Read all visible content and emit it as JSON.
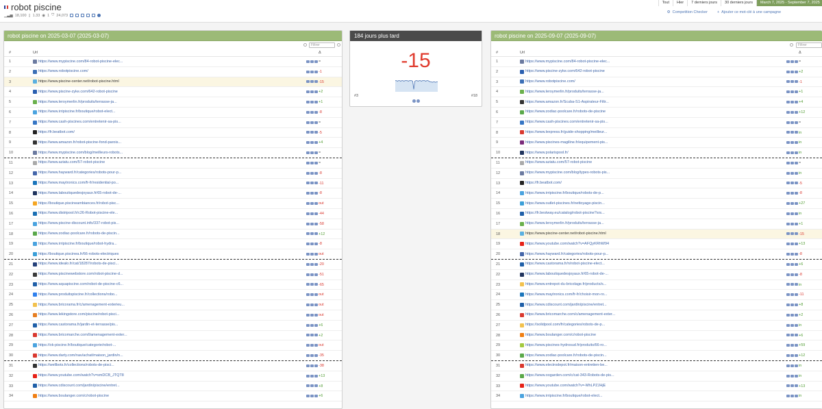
{
  "header": {
    "title": "robot piscine",
    "meta": {
      "volume": "18,100",
      "cpc": "1.33",
      "competition": "1",
      "results": "24,073"
    },
    "flag_colors": [
      "#1f3a93",
      "#ffffff",
      "#d9382f"
    ]
  },
  "period_tabs": [
    {
      "label": "Tout"
    },
    {
      "label": "Hier"
    },
    {
      "label": "7 derniers jours"
    },
    {
      "label": "30 derniers jours"
    },
    {
      "label": "March 7, 2025 - September 7, 2025"
    }
  ],
  "actions": {
    "competition_checker": "Competition Checker",
    "add_keyword": "Ajouter ce mot-clé à une campagne"
  },
  "filter_placeholder": "Filtrer",
  "columns": {
    "num": "#",
    "url": "Url",
    "delta": "Δ"
  },
  "left": {
    "title": "robot piscine on 2025-03-07 (2025-03-07)",
    "rows": [
      {
        "n": "1",
        "url": "https://www.mypiscine.com/84-robot-piscine-elec...",
        "d": "=",
        "t": "eq",
        "fav": "#6b7aa0"
      },
      {
        "n": "2",
        "url": "https://www.robotpiscine.com/",
        "d": "-1",
        "t": "neg",
        "fav": "#3b6fb6"
      },
      {
        "n": "3",
        "url": "https://www.piscine-center.net/robot-piscine.html",
        "d": "-15",
        "t": "neg",
        "fav": "#5ab0e0"
      },
      {
        "n": "4",
        "url": "https://www.piscine-zyke.com/642-robot-piscine",
        "d": "+2",
        "t": "pos",
        "fav": "#2a5fb0"
      },
      {
        "n": "5",
        "url": "https://www.leroymerlin.fr/produits/terrasse-ja...",
        "d": "+1",
        "t": "pos",
        "fav": "#6ab04c"
      },
      {
        "n": "6",
        "url": "https://www.irripiscine.fr/boutique/robot-elect...",
        "d": "-8",
        "t": "neg",
        "fav": "#4aa3df"
      },
      {
        "n": "7",
        "url": "https://www.cash-piscines.com/entretenir-sa-pis...",
        "d": "=",
        "t": "eq",
        "fav": "#3575c4"
      },
      {
        "n": "8",
        "url": "https://fr.beatbot.com/",
        "d": "-5",
        "t": "neg",
        "fav": "#222222"
      },
      {
        "n": "9",
        "url": "https://www.amazon.fr/robot-piscine-fond-parois...",
        "d": "+4",
        "t": "pos",
        "fav": "#333333"
      },
      {
        "n": "10",
        "url": "https://www.mypiscine.com/blog/meilleurs-robots...",
        "d": "=",
        "t": "eq",
        "fav": "#6b7aa0"
      },
      {
        "n": "11",
        "url": "https://www.aziatu.com/57-robot-piscine",
        "d": "=",
        "t": "eq",
        "fav": "#aaaaaa"
      },
      {
        "n": "12",
        "url": "https://www.hayward.fr/categories/robots-pour-p...",
        "d": "-8",
        "t": "neg",
        "fav": "#4466aa"
      },
      {
        "n": "13",
        "url": "https://www.maytronics.com/fr-fr/residential-po...",
        "d": "-11",
        "t": "neg",
        "fav": "#1a75bb"
      },
      {
        "n": "14",
        "url": "https://www.laboutiquedesjoyaux.fr/65-robot-de-...",
        "d": "-8",
        "t": "neg",
        "fav": "#20345e"
      },
      {
        "n": "15",
        "url": "https://boutique.piscineambiances.fr/robot-pisc...",
        "d": "out",
        "t": "out",
        "fav": "#f5a623"
      },
      {
        "n": "16",
        "url": "https://www.distripool.fr/c26-Robot-piscine-ele...",
        "d": "-44",
        "t": "neg",
        "fav": "#1a6fb3"
      },
      {
        "n": "17",
        "url": "https://www.piscine-discount.info/337-robot-pis...",
        "d": "-58",
        "t": "neg",
        "fav": "#4aa3df"
      },
      {
        "n": "18",
        "url": "https://www.zodiac-poolcare.fr/robots-de-piscin...",
        "d": "+12",
        "t": "pos",
        "fav": "#5aa84a"
      },
      {
        "n": "19",
        "url": "https://www.irripiscine.fr/boutique/robot-hydra...",
        "d": "-8",
        "t": "neg",
        "fav": "#4aa3df"
      },
      {
        "n": "20",
        "url": "https://boutique.piscinea.fr/66-robots-electriques",
        "d": "out",
        "t": "out",
        "fav": "#3b9fd8"
      },
      {
        "n": "21",
        "url": "https://www.idealo.fr/cat/18287/robots-de-pisci...",
        "d": "-20",
        "t": "neg",
        "fav": "#24407a"
      },
      {
        "n": "22",
        "url": "https://www.piscinewebstore.com/robot-piscine-d...",
        "d": "-51",
        "t": "neg",
        "fav": "#3a3a3a"
      },
      {
        "n": "23",
        "url": "https://www.aquapiscine.com/robot-de-piscine-c6...",
        "d": "-65",
        "t": "neg",
        "fav": "#1f5fa8"
      },
      {
        "n": "24",
        "url": "https://www.produitspiscine.fr/collections/robo...",
        "d": "out",
        "t": "out",
        "fav": "#2f80ed"
      },
      {
        "n": "25",
        "url": "https://www.bricorama.fr/c/amenagement-exterieu...",
        "d": "out",
        "t": "out",
        "fav": "#f2c14e"
      },
      {
        "n": "26",
        "url": "https://www.lekingstore.com/piscine/robot-pisci...",
        "d": "out",
        "t": "out",
        "fav": "#e67e22"
      },
      {
        "n": "27",
        "url": "https://www.castorama.fr/jardin-et-terrasse/pis...",
        "d": "+6",
        "t": "pos",
        "fav": "#1f5fa8"
      },
      {
        "n": "28",
        "url": "https://www.bricomarche.com/l/amenagement-exter...",
        "d": "+2",
        "t": "pos",
        "fav": "#d9382f"
      },
      {
        "n": "29",
        "url": "https://ok-piscine.fr/boutique/categorie/robot-...",
        "d": "out",
        "t": "out",
        "fav": "#4aa3df"
      },
      {
        "n": "30",
        "url": "https://www.darty.com/nav/achat/maison_jardin/n...",
        "d": "-35",
        "t": "neg",
        "fav": "#d9382f"
      },
      {
        "n": "31",
        "url": "https://wellbots.fr/collections/robots-de-pisci...",
        "d": "-38",
        "t": "neg",
        "fav": "#333333"
      },
      {
        "n": "32",
        "url": "https://www.youtube.com/watch?v=smDCB_JTQT8",
        "d": "+13",
        "t": "pos",
        "fav": "#e62117"
      },
      {
        "n": "33",
        "url": "https://www.cdiscount.com/jardin/piscine/entret...",
        "d": "+8",
        "t": "pos",
        "fav": "#1f5fa8"
      },
      {
        "n": "34",
        "url": "https://www.boulanger.com/c/robot-piscine",
        "d": "+6",
        "t": "pos",
        "fav": "#f07f13"
      }
    ]
  },
  "middle": {
    "title": "184 jours plus tard",
    "delta": "-15",
    "rank_from": "#3",
    "rank_to": "#18",
    "spark": [
      3,
      3,
      4,
      3,
      3,
      4,
      3,
      3,
      4,
      3,
      3,
      3,
      4,
      3,
      3,
      3,
      4,
      18,
      4,
      3,
      3,
      4,
      3,
      3,
      4,
      3,
      3,
      3,
      4,
      3,
      3,
      4,
      5,
      5,
      6,
      5,
      5,
      6,
      5,
      5
    ]
  },
  "right": {
    "title": "robot piscine on 2025-09-07 (2025-09-07)",
    "rows": [
      {
        "n": "1",
        "url": "https://www.mypiscine.com/84-robot-piscine-elec...",
        "d": "=",
        "t": "eq",
        "fav": "#6b7aa0"
      },
      {
        "n": "2",
        "url": "https://www.piscine-zyke.com/642-robot-piscine",
        "d": "+2",
        "t": "pos",
        "fav": "#2a5fb0"
      },
      {
        "n": "3",
        "url": "https://www.robotpiscine.com/",
        "d": "-1",
        "t": "neg",
        "fav": "#3b6fb6"
      },
      {
        "n": "4",
        "url": "https://www.leroymerlin.fr/produits/terrasse-ja...",
        "d": "+1",
        "t": "pos",
        "fav": "#6ab04c"
      },
      {
        "n": "5",
        "url": "https://www.amazon.fr/Scuba-S1-Aspirateur-Filtr...",
        "d": "+4",
        "t": "pos",
        "fav": "#333333"
      },
      {
        "n": "6",
        "url": "https://www.zodiac-poolcare.fr/robots-de-piscine",
        "d": "+12",
        "t": "pos",
        "fav": "#5aa84a"
      },
      {
        "n": "7",
        "url": "https://www.cash-piscines.com/entretenir-sa-pis...",
        "d": "=",
        "t": "eq",
        "fav": "#3575c4"
      },
      {
        "n": "8",
        "url": "https://www.lexpress.fr/guide-shopping/meilleur...",
        "d": "in",
        "t": "in",
        "fav": "#d9382f"
      },
      {
        "n": "9",
        "url": "https://www.piscines-magiline.fr/equipement-pis...",
        "d": "in",
        "t": "in",
        "fav": "#7a2a7a"
      },
      {
        "n": "10",
        "url": "https://www.polarispool.fr/",
        "d": "in",
        "t": "in",
        "fav": "#20345e"
      },
      {
        "n": "11",
        "url": "https://www.aziatu.com/57-robot-piscine",
        "d": "=",
        "t": "eq",
        "fav": "#aaaaaa"
      },
      {
        "n": "12",
        "url": "https://www.mypiscine.com/blog/types-robots-pis...",
        "d": "in",
        "t": "in",
        "fav": "#6b7aa0"
      },
      {
        "n": "13",
        "url": "https://fr.beatbot.com/",
        "d": "-5",
        "t": "neg",
        "fav": "#222222"
      },
      {
        "n": "14",
        "url": "https://www.irripiscine.fr/boutique/robots-de-p...",
        "d": "-8",
        "t": "neg",
        "fav": "#4aa3df"
      },
      {
        "n": "15",
        "url": "https://www.outlet-piscines.fr/nettoyage-piscin...",
        "d": "+27",
        "t": "pos",
        "fav": "#3b9fd8"
      },
      {
        "n": "16",
        "url": "https://fr.bestway.eu/catalog/robot-piscine?srs...",
        "d": "in",
        "t": "in",
        "fav": "#1f5fa8"
      },
      {
        "n": "17",
        "url": "https://www.leroymerlin.fr/produits/terrasse-ja...",
        "d": "+1",
        "t": "pos",
        "fav": "#6ab04c"
      },
      {
        "n": "18",
        "url": "https://www.piscine-center.net/robot-piscine.html",
        "d": "-15",
        "t": "neg",
        "fav": "#5ab0e0"
      },
      {
        "n": "19",
        "url": "https://www.youtube.com/watch?v=AFQyKRhW94",
        "d": "+13",
        "t": "pos",
        "fav": "#e62117"
      },
      {
        "n": "20",
        "url": "https://www.hayward.fr/categories/robots-pour-p...",
        "d": "-8",
        "t": "neg",
        "fav": "#4466aa"
      },
      {
        "n": "21",
        "url": "https://www.castorama.fr/n/robot-piscine-elect...",
        "d": "+6",
        "t": "pos",
        "fav": "#1f5fa8"
      },
      {
        "n": "22",
        "url": "https://www.laboutiquedesjoyaux.fr/65-robot-de-...",
        "d": "-8",
        "t": "neg",
        "fav": "#20345e"
      },
      {
        "n": "23",
        "url": "https://www.entrepot-du-bricolage.fr/products/s...",
        "d": "in",
        "t": "in",
        "fav": "#f2c14e"
      },
      {
        "n": "24",
        "url": "https://www.maytronics.com/fr-fr/choisir-mon-ro...",
        "d": "-11",
        "t": "neg",
        "fav": "#1a75bb"
      },
      {
        "n": "25",
        "url": "https://www.cdiscount.com/jardin/piscine/entret...",
        "d": "+8",
        "t": "pos",
        "fav": "#1f5fa8"
      },
      {
        "n": "26",
        "url": "https://www.bricomarche.com/c/amenagement-exter...",
        "d": "+2",
        "t": "pos",
        "fav": "#d9382f"
      },
      {
        "n": "27",
        "url": "https://solidpool.com/fr/categories/robots-de-p...",
        "d": "in",
        "t": "in",
        "fav": "#f2c14e"
      },
      {
        "n": "28",
        "url": "https://www.boulanger.com/c/robot-piscine",
        "d": "+6",
        "t": "pos",
        "fav": "#f07f13"
      },
      {
        "n": "29",
        "url": "https://www.piscines-hydrosud.fr/produits/66-ro...",
        "d": "+59",
        "t": "pos",
        "fav": "#a3c940"
      },
      {
        "n": "30",
        "url": "https://www.zodiac-poolcare.fr/robots-de-piscin...",
        "d": "+12",
        "t": "pos",
        "fav": "#5aa84a"
      },
      {
        "n": "31",
        "url": "https://www.electrodepot.fr/maison-entretien-be...",
        "d": "in",
        "t": "in",
        "fav": "#d9382f"
      },
      {
        "n": "32",
        "url": "https://www.oogarden.com/c/cat-343-Robots-de-pis...",
        "d": "in",
        "t": "in",
        "fav": "#5aa84a"
      },
      {
        "n": "33",
        "url": "https://www.youtube.com/watch?v=-MhLPZJHjE",
        "d": "+13",
        "t": "pos",
        "fav": "#e62117"
      },
      {
        "n": "34",
        "url": "https://www.irripiscine.fr/boutique/robot-elect...",
        "d": "in",
        "t": "in",
        "fav": "#4aa3df"
      }
    ]
  }
}
